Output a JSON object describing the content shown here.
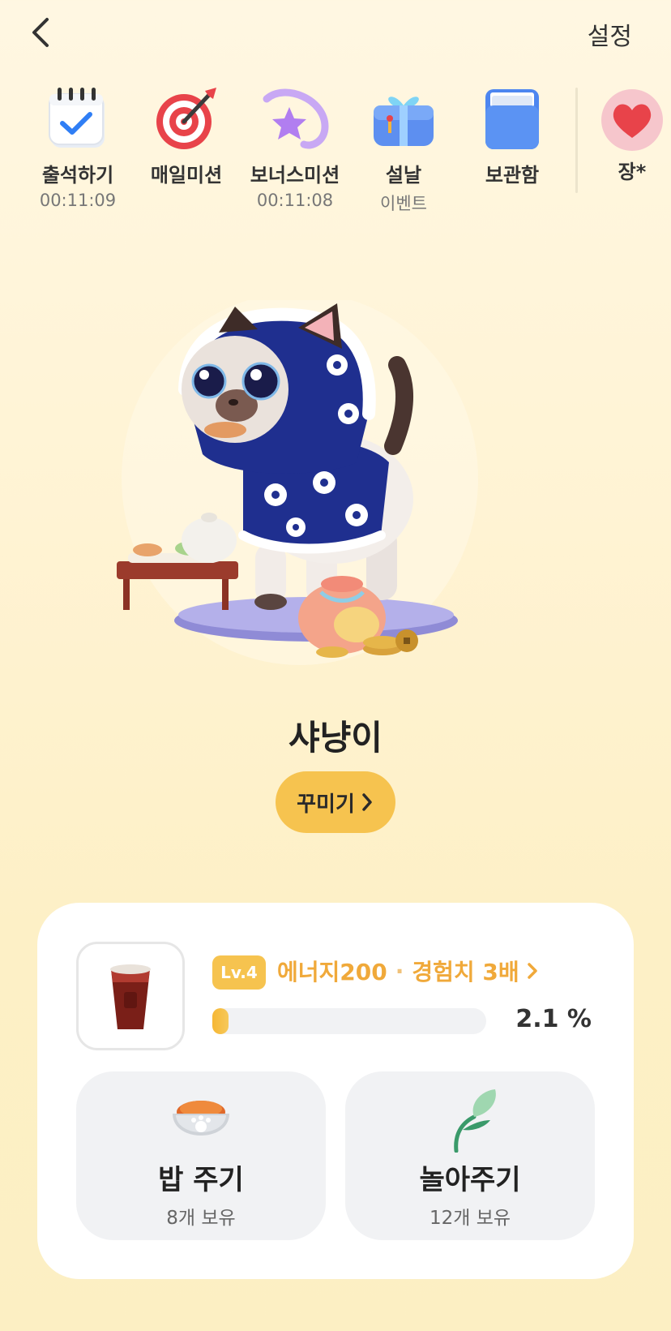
{
  "header": {
    "back_icon": "chevron-left-icon",
    "settings_label": "설정"
  },
  "menu": [
    {
      "label": "출석하기",
      "sub": "00:11:09",
      "icon": "calendar-check-icon"
    },
    {
      "label": "매일미션",
      "sub": "",
      "icon": "target-icon"
    },
    {
      "label": "보너스미션",
      "sub": "00:11:08",
      "icon": "star-orbit-icon"
    },
    {
      "label": "설날",
      "sub": "이벤트",
      "icon": "gift-box-icon"
    },
    {
      "label": "보관함",
      "sub": "",
      "icon": "storage-box-icon"
    },
    {
      "label": "장*",
      "sub": "",
      "icon": "heart-icon"
    }
  ],
  "character": {
    "name": "샤냥이",
    "decorate_label": "꾸미기"
  },
  "status": {
    "level": "Lv.4",
    "energy": "에너지200",
    "exp": "경험치 3배",
    "progress_text": "2.1 %",
    "progress_value": 0.021
  },
  "actions": {
    "feed": {
      "title": "밥 주기",
      "sub": "8개 보유"
    },
    "play": {
      "title": "놀아주기",
      "sub": "12개 보유"
    }
  },
  "colors": {
    "accent": "#f6c34f",
    "accent_text": "#f0a93a",
    "background": "#fff5da",
    "card": "#ffffff",
    "button_bg": "#f1f2f4"
  }
}
